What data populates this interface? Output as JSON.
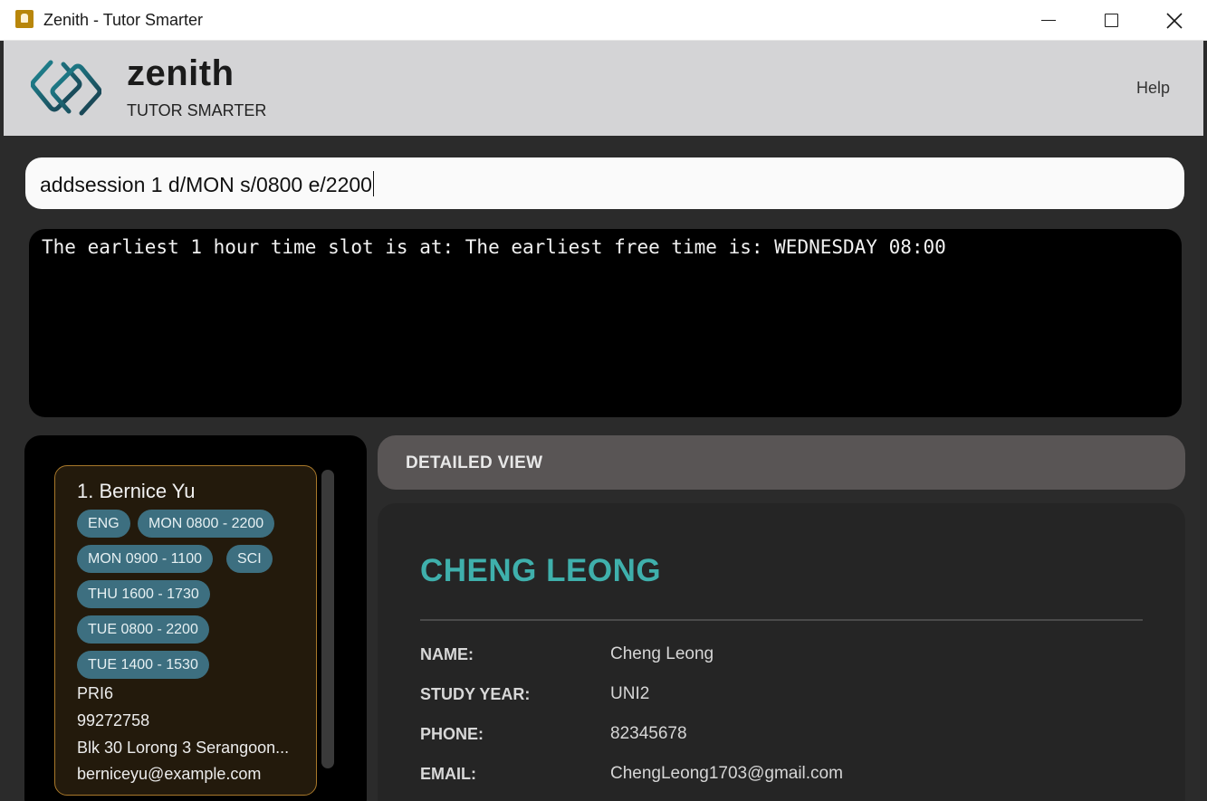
{
  "window": {
    "title": "Zenith - Tutor Smarter"
  },
  "header": {
    "brand": "zenith",
    "tagline": "TUTOR SMARTER",
    "menu_help": "Help"
  },
  "command": {
    "input_value": "addsession 1 d/MON s/0800 e/2200"
  },
  "result": {
    "message": "The earliest 1 hour time slot is at: The earliest free time is: WEDNESDAY 08:00"
  },
  "student_list": {
    "items": [
      {
        "name": "1. Bernice Yu",
        "tags": [
          "ENG",
          "MON 0800 - 2200",
          "MON 0900 - 1100",
          "SCI",
          "THU 1600 - 1730",
          "TUE 0800 - 2200",
          "TUE 1400 - 1530"
        ],
        "level": "PRI6",
        "phone": "99272758",
        "address": "Blk 30 Lorong 3 Serangoon...",
        "email": "berniceyu@example.com"
      }
    ]
  },
  "detail": {
    "header": "DETAILED VIEW",
    "title": "CHENG LEONG",
    "fields": [
      {
        "label": "NAME:",
        "value": "Cheng Leong"
      },
      {
        "label": "STUDY YEAR:",
        "value": "UNI2"
      },
      {
        "label": "PHONE:",
        "value": "82345678"
      },
      {
        "label": "EMAIL:",
        "value": "ChengLeong1703@gmail.com"
      }
    ]
  },
  "colors": {
    "accent": "#3fb0ac",
    "tag_bg": "#3d6f80",
    "card_border": "#a8782a"
  }
}
